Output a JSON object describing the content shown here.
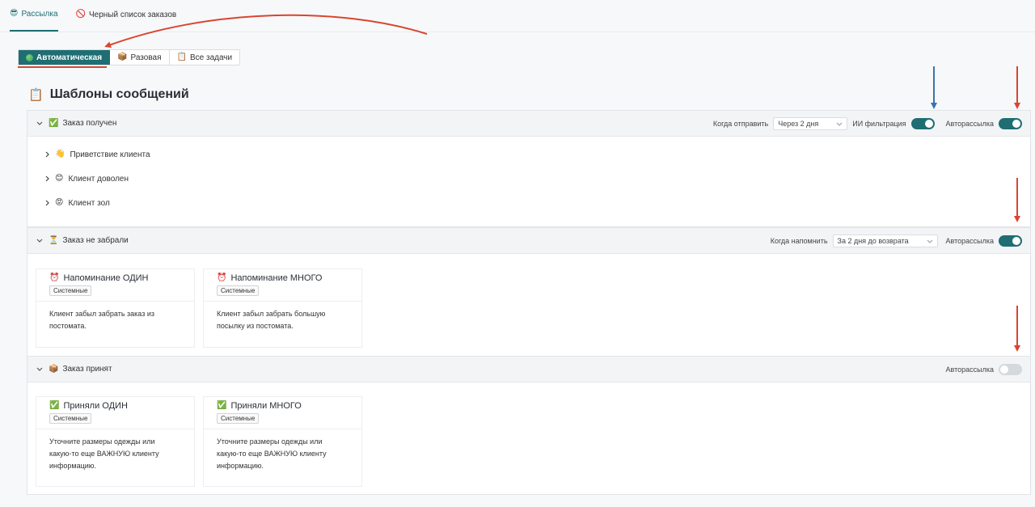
{
  "top_tabs": [
    {
      "icon": "😎",
      "label": "Рассылка",
      "active": true
    },
    {
      "icon": "🚫",
      "label": "Черный список заказов",
      "active": false
    }
  ],
  "segments": [
    {
      "label": "Автоматическая",
      "active": true
    },
    {
      "icon": "📦",
      "label": "Разовая",
      "active": false
    },
    {
      "icon": "📋",
      "label": "Все задачи",
      "active": false
    }
  ],
  "page_title": {
    "icon": "📋",
    "text": "Шаблоны сообщений"
  },
  "sections": [
    {
      "icon": "✅",
      "title": "Заказ получен",
      "when_label": "Когда отправить",
      "when_value": "Через 2 дня",
      "ai_label": "ИИ фильтрация",
      "ai_on": true,
      "auto_label": "Авторассылка",
      "auto_on": true,
      "subitems": [
        {
          "icon": "👋",
          "label": "Приветствие клиента"
        },
        {
          "icon": "😊",
          "label": "Клиент доволен"
        },
        {
          "icon": "😡",
          "label": "Клиент зол"
        }
      ]
    },
    {
      "icon": "⏳",
      "title": "Заказ не забрали",
      "when_label": "Когда напомнить",
      "when_value": "За 2 дня до возврата",
      "auto_label": "Авторассылка",
      "auto_on": true,
      "cards": [
        {
          "icon": "⏰",
          "title": "Напоминание ОДИН",
          "badge": "Системные",
          "body": [
            "Клиент забыл забрать заказ из",
            "постомата."
          ]
        },
        {
          "icon": "⏰",
          "title": "Напоминание МНОГО",
          "badge": "Системные",
          "body": [
            "Клиент забыл забрать большую",
            "посылку из постомата."
          ]
        }
      ]
    },
    {
      "icon": "📦",
      "title": "Заказ принят",
      "auto_label": "Авторассылка",
      "auto_on": false,
      "cards": [
        {
          "icon": "✅",
          "title": "Приняли ОДИН",
          "badge": "Системные",
          "body": [
            "Уточните размеры одежды или",
            "какую-то еще ВАЖНУЮ клиенту",
            "информацию."
          ]
        },
        {
          "icon": "✅",
          "title": "Приняли МНОГО",
          "badge": "Системные",
          "body": [
            "Уточните размеры одежды или",
            "какую-то еще ВАЖНУЮ клиенту",
            "информацию."
          ]
        }
      ]
    }
  ],
  "colors": {
    "accent": "#1e6e73",
    "arrow_red": "#d9452f",
    "arrow_blue": "#3a72b0"
  }
}
